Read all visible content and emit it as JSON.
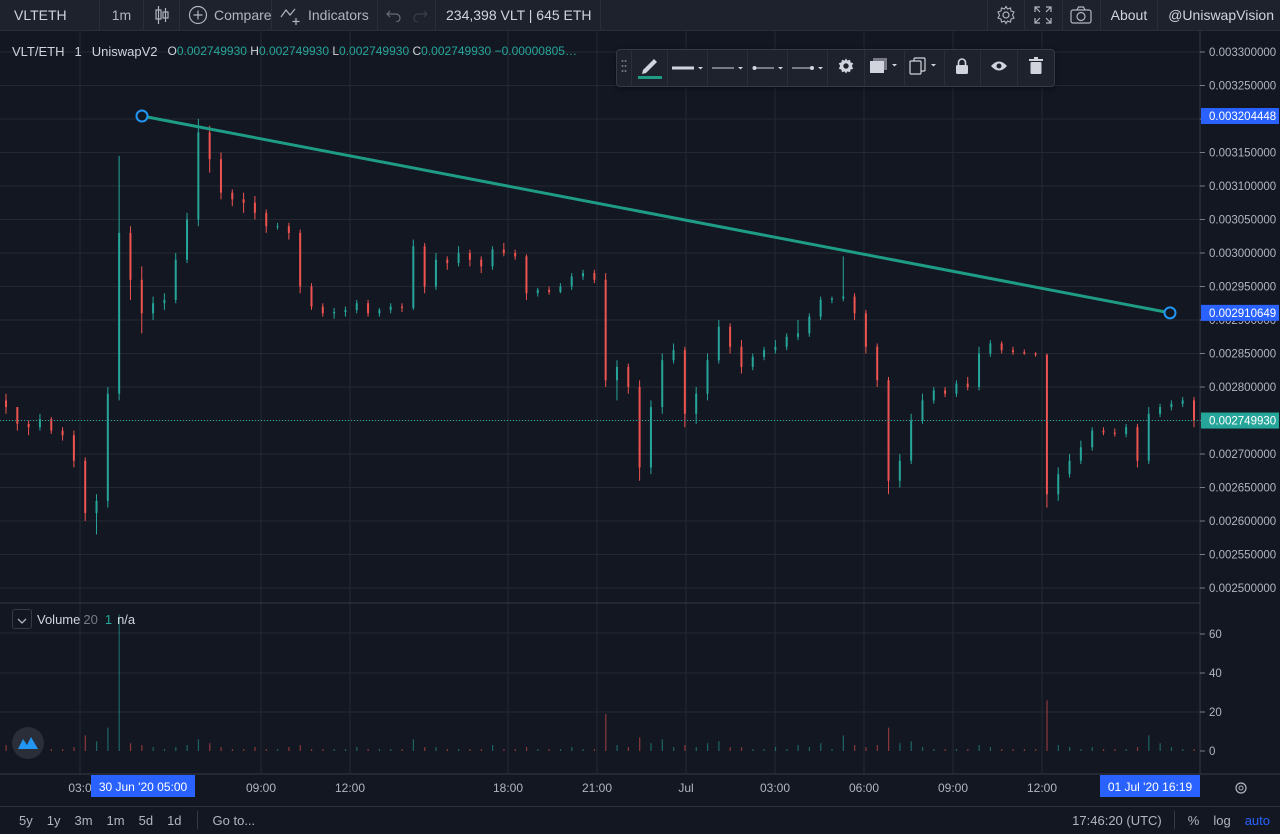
{
  "toolbar": {
    "symbol": "VLTETH",
    "interval": "1m",
    "compare_label": "Compare",
    "indicators_label": "Indicators",
    "liquidity": "234,398 VLT | 645 ETH",
    "about_label": "About",
    "user_label": "@UniswapVision"
  },
  "legend": {
    "pair": "VLT/ETH",
    "interval": "1",
    "exchange": "UniswapV2",
    "open_key": "O",
    "open": "0.002749930",
    "high_key": "H",
    "high": "0.002749930",
    "low_key": "L",
    "low": "0.002749930",
    "close_key": "C",
    "close": "0.002749930",
    "change": "−0.00000805…"
  },
  "volume_legend": {
    "name": "Volume",
    "length": "20",
    "value1": "1",
    "value2": "n/a"
  },
  "price_axis": {
    "ticks": [
      "0.003300000",
      "0.003250000",
      "0.003200000",
      "0.003150000",
      "0.003100000",
      "0.003050000",
      "0.003000000",
      "0.002950000",
      "0.002900000",
      "0.002850000",
      "0.002800000",
      "0.002750000",
      "0.002700000",
      "0.002650000",
      "0.002600000",
      "0.002550000",
      "0.002500000"
    ],
    "trend_start_label": "0.003204448",
    "trend_end_label": "0.002910649",
    "last_price_label": "0.002749930"
  },
  "volume_axis": {
    "ticks": [
      "60",
      "40",
      "20",
      "0"
    ]
  },
  "time_axis": {
    "ticks": [
      "03:0",
      "09:00",
      "12:00",
      "18:00",
      "21:00",
      "Jul",
      "03:00",
      "06:00",
      "09:00",
      "12:00"
    ],
    "start_badge": "30 Jun '20  05:00",
    "end_badge": "01 Jul '20  16:19"
  },
  "bottom_bar": {
    "ranges": [
      "5y",
      "1y",
      "3m",
      "1m",
      "5d",
      "1d"
    ],
    "goto_label": "Go to...",
    "clock": "17:46:20 (UTC)",
    "percent_label": "%",
    "log_label": "log",
    "auto_label": "auto"
  },
  "colors": {
    "up": "#26a69a",
    "down": "#ef5350",
    "trendline": "#1e9c85",
    "accent": "#2962ff",
    "background": "#131722"
  },
  "chart_data": {
    "type": "candlestick",
    "y_range": [
      0.00248,
      0.003335
    ],
    "volume_range": [
      0,
      80
    ],
    "trendline": {
      "from": 0.003204448,
      "to": 0.002910649
    },
    "last_price": 0.00274993,
    "candles": [
      [
        0.00278,
        0.00279,
        0.00276,
        0.00277
      ],
      [
        0.00277,
        0.00277,
        0.002735,
        0.002745
      ],
      [
        0.002745,
        0.00275,
        0.002728,
        0.00274
      ],
      [
        0.00274,
        0.00276,
        0.002735,
        0.002752
      ],
      [
        0.002752,
        0.002755,
        0.00273,
        0.002735
      ],
      [
        0.002735,
        0.00274,
        0.00272,
        0.002728
      ],
      [
        0.002728,
        0.002735,
        0.00268,
        0.00269
      ],
      [
        0.00269,
        0.002695,
        0.0026,
        0.002612
      ],
      [
        0.002612,
        0.00264,
        0.00258,
        0.00263
      ],
      [
        0.00263,
        0.0028,
        0.00262,
        0.00279
      ],
      [
        0.00279,
        0.003145,
        0.00278,
        0.00303
      ],
      [
        0.00303,
        0.00304,
        0.00293,
        0.00296
      ],
      [
        0.00296,
        0.00298,
        0.00288,
        0.00291
      ],
      [
        0.00291,
        0.002935,
        0.0029,
        0.002925
      ],
      [
        0.002925,
        0.00294,
        0.002915,
        0.00293
      ],
      [
        0.00293,
        0.003,
        0.002925,
        0.00299
      ],
      [
        0.00299,
        0.00306,
        0.002985,
        0.00305
      ],
      [
        0.00305,
        0.0032,
        0.00304,
        0.00318
      ],
      [
        0.00318,
        0.00319,
        0.00312,
        0.00314
      ],
      [
        0.00314,
        0.00315,
        0.00308,
        0.00309
      ],
      [
        0.00309,
        0.003095,
        0.00307,
        0.00308
      ],
      [
        0.00308,
        0.00309,
        0.00306,
        0.003075
      ],
      [
        0.003075,
        0.003085,
        0.00305,
        0.00306
      ],
      [
        0.00306,
        0.003065,
        0.00303,
        0.00304
      ],
      [
        0.00304,
        0.003045,
        0.003035,
        0.00304
      ],
      [
        0.00304,
        0.003045,
        0.00302,
        0.00303
      ],
      [
        0.00303,
        0.003035,
        0.00294,
        0.00295
      ],
      [
        0.00295,
        0.002955,
        0.002915,
        0.00292
      ],
      [
        0.00292,
        0.002925,
        0.002905,
        0.00291
      ],
      [
        0.00291,
        0.002918,
        0.002902,
        0.002912
      ],
      [
        0.002912,
        0.00292,
        0.002905,
        0.002915
      ],
      [
        0.002915,
        0.00293,
        0.00291,
        0.002925
      ],
      [
        0.002925,
        0.00293,
        0.002905,
        0.00291
      ],
      [
        0.00291,
        0.002918,
        0.002905,
        0.002915
      ],
      [
        0.002915,
        0.002925,
        0.00291,
        0.00292
      ],
      [
        0.00292,
        0.002925,
        0.002912,
        0.002918
      ],
      [
        0.002918,
        0.00302,
        0.002915,
        0.00301
      ],
      [
        0.00301,
        0.003015,
        0.00294,
        0.00295
      ],
      [
        0.00295,
        0.003,
        0.002945,
        0.00299
      ],
      [
        0.00299,
        0.002995,
        0.002975,
        0.002985
      ],
      [
        0.002985,
        0.00301,
        0.00298,
        0.003
      ],
      [
        0.003,
        0.003005,
        0.00298,
        0.00299
      ],
      [
        0.00299,
        0.002995,
        0.00297,
        0.00298
      ],
      [
        0.00298,
        0.00301,
        0.002975,
        0.003005
      ],
      [
        0.003005,
        0.003015,
        0.002995,
        0.003
      ],
      [
        0.003,
        0.003005,
        0.00299,
        0.002995
      ],
      [
        0.002995,
        0.002998,
        0.00293,
        0.00294
      ],
      [
        0.00294,
        0.002948,
        0.002935,
        0.002945
      ],
      [
        0.002945,
        0.00295,
        0.002938,
        0.002942
      ],
      [
        0.002942,
        0.002955,
        0.00294,
        0.00295
      ],
      [
        0.00295,
        0.00297,
        0.002945,
        0.002965
      ],
      [
        0.002965,
        0.002975,
        0.00296,
        0.00297
      ],
      [
        0.00297,
        0.002975,
        0.002955,
        0.00296
      ],
      [
        0.00296,
        0.00297,
        0.0028,
        0.00281
      ],
      [
        0.00281,
        0.00284,
        0.00278,
        0.00283
      ],
      [
        0.00283,
        0.002835,
        0.00279,
        0.0028
      ],
      [
        0.0028,
        0.00281,
        0.00266,
        0.00268
      ],
      [
        0.00268,
        0.00278,
        0.00267,
        0.00277
      ],
      [
        0.00277,
        0.00285,
        0.00276,
        0.00284
      ],
      [
        0.00284,
        0.002865,
        0.002835,
        0.002855
      ],
      [
        0.002855,
        0.00286,
        0.00274,
        0.00276
      ],
      [
        0.00276,
        0.0028,
        0.002745,
        0.00279
      ],
      [
        0.00279,
        0.00285,
        0.00278,
        0.00284
      ],
      [
        0.00284,
        0.0029,
        0.002835,
        0.00289
      ],
      [
        0.00289,
        0.002895,
        0.00285,
        0.00286
      ],
      [
        0.00286,
        0.00287,
        0.00282,
        0.00283
      ],
      [
        0.00283,
        0.00285,
        0.002825,
        0.002845
      ],
      [
        0.002845,
        0.00286,
        0.00284,
        0.002855
      ],
      [
        0.002855,
        0.00287,
        0.00285,
        0.00286
      ],
      [
        0.00286,
        0.00288,
        0.002855,
        0.002875
      ],
      [
        0.002875,
        0.0029,
        0.00287,
        0.00288
      ],
      [
        0.00288,
        0.00291,
        0.002875,
        0.002905
      ],
      [
        0.002905,
        0.002935,
        0.0029,
        0.00293
      ],
      [
        0.00293,
        0.002935,
        0.002925,
        0.002932
      ],
      [
        0.002932,
        0.002995,
        0.002928,
        0.002935
      ],
      [
        0.002935,
        0.00294,
        0.0029,
        0.00291
      ],
      [
        0.00291,
        0.002915,
        0.00285,
        0.00286
      ],
      [
        0.00286,
        0.002865,
        0.0028,
        0.00281
      ],
      [
        0.00281,
        0.002815,
        0.00264,
        0.00266
      ],
      [
        0.00266,
        0.0027,
        0.00265,
        0.00269
      ],
      [
        0.00269,
        0.00276,
        0.002685,
        0.00275
      ],
      [
        0.00275,
        0.00279,
        0.002745,
        0.00278
      ],
      [
        0.00278,
        0.0028,
        0.002775,
        0.002795
      ],
      [
        0.002795,
        0.0028,
        0.002785,
        0.00279
      ],
      [
        0.00279,
        0.00281,
        0.002785,
        0.002805
      ],
      [
        0.002805,
        0.002815,
        0.002795,
        0.0028
      ],
      [
        0.0028,
        0.00286,
        0.002795,
        0.00285
      ],
      [
        0.00285,
        0.00287,
        0.002845,
        0.002865
      ],
      [
        0.002865,
        0.002868,
        0.00285,
        0.002855
      ],
      [
        0.002855,
        0.00286,
        0.002848,
        0.002852
      ],
      [
        0.002852,
        0.002856,
        0.002848,
        0.00285
      ],
      [
        0.00285,
        0.002852,
        0.002845,
        0.002848
      ],
      [
        0.002848,
        0.00285,
        0.00262,
        0.00264
      ],
      [
        0.00264,
        0.00268,
        0.00263,
        0.00267
      ],
      [
        0.00267,
        0.0027,
        0.002665,
        0.00269
      ],
      [
        0.00269,
        0.00272,
        0.002685,
        0.00271
      ],
      [
        0.00271,
        0.00274,
        0.002705,
        0.002735
      ],
      [
        0.002735,
        0.00274,
        0.002728,
        0.002732
      ],
      [
        0.002732,
        0.002738,
        0.002726,
        0.00273
      ],
      [
        0.00273,
        0.002745,
        0.002725,
        0.00274
      ],
      [
        0.00274,
        0.002745,
        0.00268,
        0.00269
      ],
      [
        0.00269,
        0.00277,
        0.002685,
        0.00276
      ],
      [
        0.00276,
        0.002775,
        0.002755,
        0.00277
      ],
      [
        0.00277,
        0.00278,
        0.002765,
        0.002775
      ],
      [
        0.002775,
        0.002785,
        0.00277,
        0.00278
      ],
      [
        0.00278,
        0.002785,
        0.00274,
        0.00275
      ]
    ],
    "volumes": [
      3,
      2,
      1,
      2,
      1,
      1,
      2,
      8,
      5,
      12,
      70,
      4,
      3,
      2,
      1,
      2,
      3,
      6,
      4,
      2,
      1,
      1,
      2,
      1,
      1,
      2,
      3,
      1,
      1,
      1,
      1,
      2,
      1,
      1,
      1,
      1,
      6,
      2,
      2,
      1,
      1,
      1,
      1,
      3,
      1,
      1,
      2,
      1,
      1,
      1,
      2,
      1,
      1,
      19,
      3,
      2,
      7,
      4,
      6,
      2,
      3,
      2,
      4,
      5,
      2,
      2,
      1,
      1,
      2,
      1,
      3,
      2,
      4,
      1,
      8,
      3,
      2,
      3,
      12,
      4,
      5,
      2,
      1,
      1,
      1,
      1,
      3,
      2,
      1,
      1,
      1,
      1,
      26,
      3,
      2,
      1,
      2,
      1,
      1,
      1,
      2,
      8,
      4,
      2,
      1,
      1
    ]
  }
}
